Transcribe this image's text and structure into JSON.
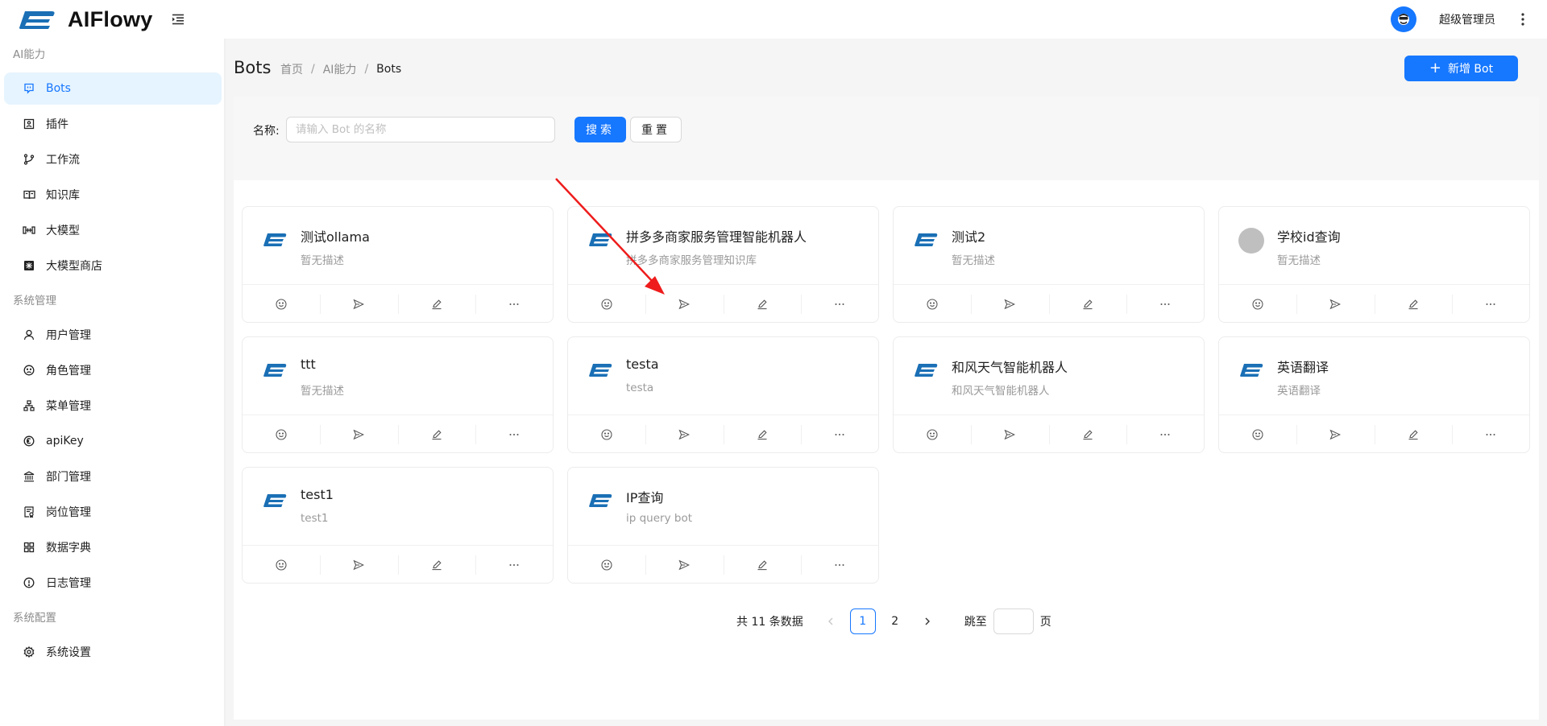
{
  "app": {
    "name": "AIFlowy",
    "user_name": "超级管理员"
  },
  "sidebar": {
    "groups": [
      {
        "title": "AI能力",
        "items": [
          {
            "label": "Bots",
            "icon": "bot-icon",
            "active": true
          },
          {
            "label": "插件",
            "icon": "plugin-icon"
          },
          {
            "label": "工作流",
            "icon": "workflow-icon"
          },
          {
            "label": "知识库",
            "icon": "knowledge-book-icon"
          },
          {
            "label": "大模型",
            "icon": "model-icon"
          },
          {
            "label": "大模型商店",
            "icon": "model-store-icon"
          }
        ]
      },
      {
        "title": "系统管理",
        "items": [
          {
            "label": "用户管理",
            "icon": "user-icon"
          },
          {
            "label": "角色管理",
            "icon": "role-icon"
          },
          {
            "label": "菜单管理",
            "icon": "menu-tree-icon"
          },
          {
            "label": "apiKey",
            "icon": "key-coin-icon"
          },
          {
            "label": "部门管理",
            "icon": "bank-icon"
          },
          {
            "label": "岗位管理",
            "icon": "job-doc-icon"
          },
          {
            "label": "数据字典",
            "icon": "grid-icon"
          },
          {
            "label": "日志管理",
            "icon": "info-circle-icon"
          }
        ]
      },
      {
        "title": "系统配置",
        "items": [
          {
            "label": "系统设置",
            "icon": "gear-icon"
          }
        ]
      }
    ]
  },
  "page": {
    "title": "Bots",
    "breadcrumb": [
      "首页",
      "AI能力",
      "Bots"
    ],
    "new_button_label": "新增 Bot"
  },
  "search": {
    "label": "名称:",
    "placeholder": "请输入 Bot 的名称",
    "value": "",
    "search_label": "搜索",
    "reset_label": "重置"
  },
  "bots": [
    {
      "title": "测试ollama",
      "desc": "暂无描述",
      "logo": "aiflowy"
    },
    {
      "title": "拼多多商家服务管理智能机器人",
      "desc": "拼多多商家服务管理知识库",
      "logo": "aiflowy"
    },
    {
      "title": "测试2",
      "desc": "暂无描述",
      "logo": "aiflowy"
    },
    {
      "title": "学校id查询",
      "desc": "暂无描述",
      "logo": "gray-circle"
    },
    {
      "title": "ttt",
      "desc": "暂无描述",
      "logo": "aiflowy"
    },
    {
      "title": "testa",
      "desc": "testa",
      "logo": "aiflowy"
    },
    {
      "title": "和风天气智能机器人",
      "desc": "和风天气智能机器人",
      "logo": "aiflowy"
    },
    {
      "title": "英语翻译",
      "desc": "英语翻译",
      "logo": "aiflowy"
    },
    {
      "title": "test1",
      "desc": "test1",
      "logo": "aiflowy"
    },
    {
      "title": "IP查询",
      "desc": "ip query bot",
      "logo": "aiflowy"
    }
  ],
  "card_actions": [
    "smile-icon",
    "send-icon",
    "edit-icon",
    "more-icon"
  ],
  "pagination": {
    "total_text": "共 11 条数据",
    "pages": [
      "1",
      "2"
    ],
    "current": "1",
    "jump_label": "跳至",
    "page_suffix": "页"
  },
  "colors": {
    "primary": "#1677ff",
    "logo_blue": "#1a6fb5",
    "annotation": "#ee1c1c"
  }
}
